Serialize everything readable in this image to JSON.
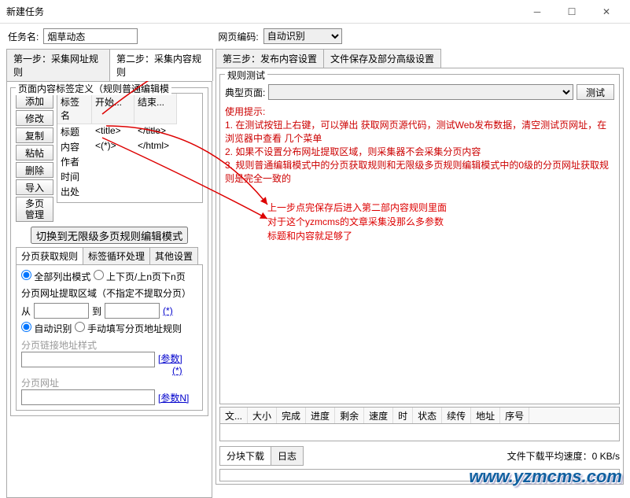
{
  "window": {
    "title": "新建任务"
  },
  "top": {
    "taskname_label": "任务名:",
    "taskname_value": "烟草动态",
    "encoding_label": "网页编码:",
    "encoding_value": "自动识别"
  },
  "steps": {
    "s1": "第一步：采集网址规则",
    "s2": "第二步：采集内容规则",
    "s3": "第三步：发布内容设置",
    "s4": "文件保存及部分高级设置"
  },
  "left": {
    "fieldset_title": "页面内容标签定义（规则普通编辑模",
    "buttons": {
      "add": "添加",
      "edit": "修改",
      "copy": "复制",
      "paste": "粘帖",
      "del": "删除",
      "import": "导入",
      "multi1": "多页",
      "multi2": "管理"
    },
    "headers": {
      "name": "标签名",
      "start": "开始...",
      "end": "结束..."
    },
    "rows": [
      {
        "name": "标题",
        "start": "<title>",
        "end": "</title>"
      },
      {
        "name": "内容",
        "start": "<(*)>",
        "end": "</html>"
      },
      {
        "name": "作者",
        "start": "",
        "end": ""
      },
      {
        "name": "时间",
        "start": "",
        "end": ""
      },
      {
        "name": "出处",
        "start": "",
        "end": ""
      }
    ],
    "switch_mode": "切换到无限级多页规则编辑模式",
    "subtabs": {
      "t1": "分页获取规则",
      "t2": "标签循环处理",
      "t3": "其他设置"
    },
    "paging": {
      "mode_all": "全部列出模式",
      "mode_updown": "上下页/上n页下n页",
      "extract_label": "分页网址提取区域（不指定不提取分页）",
      "from": "从",
      "to": "到",
      "star": "(*)",
      "auto": "自动识别",
      "manual": "手动填写分页地址规则",
      "link_style": "分页链接地址样式",
      "param": "[参数]",
      "star2": "(*)",
      "page_url": "分页网址",
      "paramN": "[参数N]"
    }
  },
  "right": {
    "test_title": "规则测试",
    "typical_label": "典型页面:",
    "test_btn": "测试",
    "tips_title": "使用提示:",
    "tip1": "1. 在测试按钮上右键，可以弹出 获取网页源代码，测试Web发布数据，清空测试页网址，在浏览器中查看 几个菜单",
    "tip2": "2. 如果不设置分布网址提取区域，则采集器不会采集分页内容",
    "tip3": "3. 规则普通编辑模式中的分页获取规则和无限级多页规则编辑模式中的0级的分页网址获取规则是完全一致的",
    "annot1": "上一步点完保存后进入第二部内容规则里面",
    "annot2": "对于这个yzmcms的文章采集没那么多参数",
    "annot3": "标题和内容就足够了",
    "cols": [
      "文...",
      "大小",
      "完成",
      "进度",
      "剩余",
      "速度",
      "时",
      "状态",
      "续传",
      "地址",
      "序号"
    ],
    "chunk_dl": "分块下载",
    "log": "日志",
    "avg_label": "文件下载平均速度：",
    "avg_value": "0 KB/s"
  },
  "watermark": "www.yzmcms.com"
}
